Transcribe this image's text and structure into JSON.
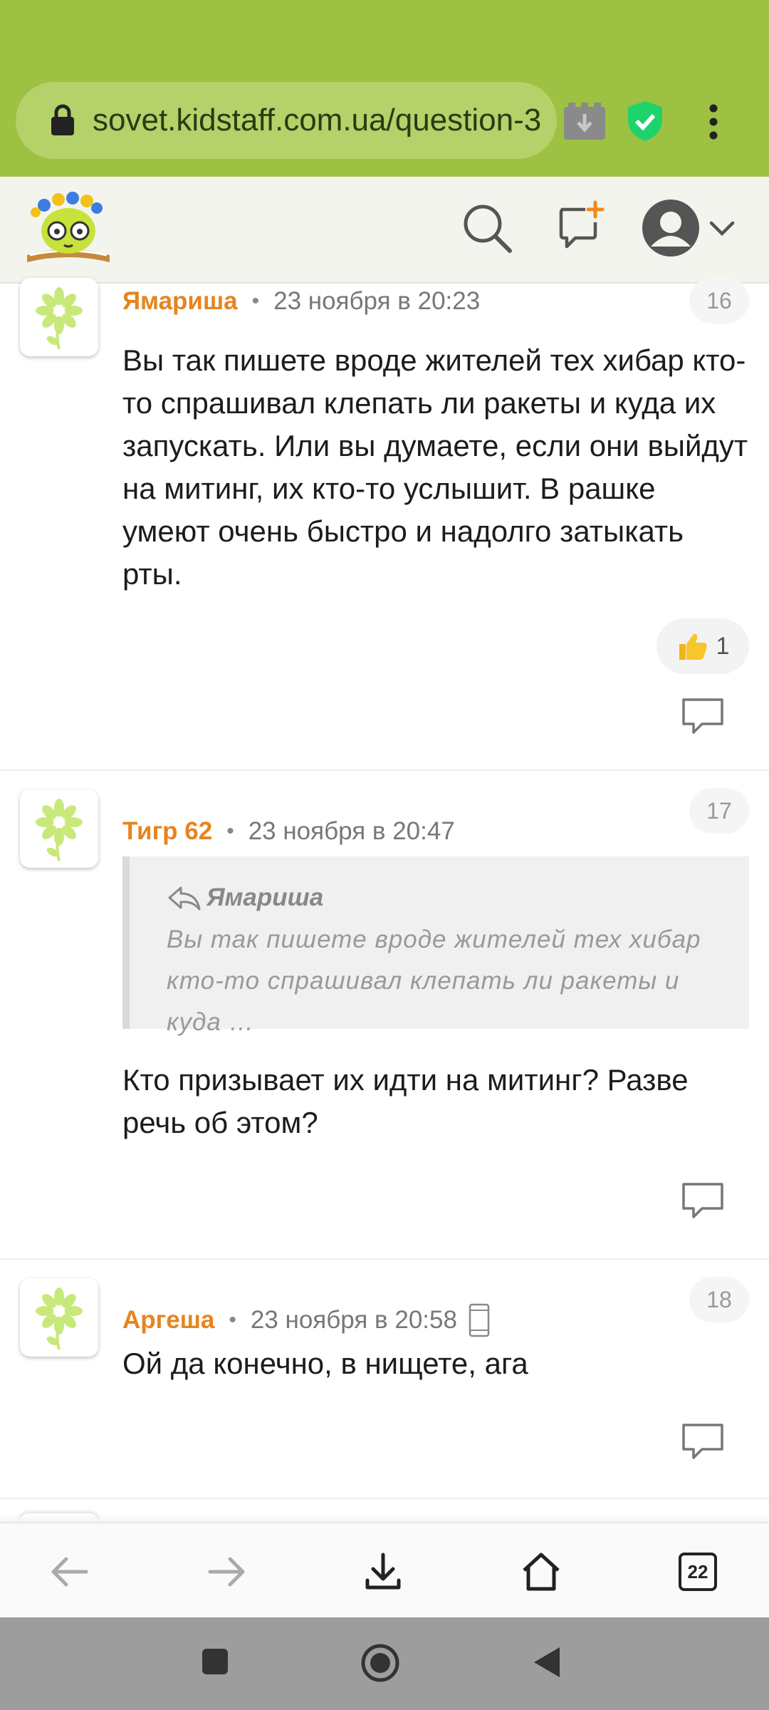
{
  "browser": {
    "url": "sovet.kidstaff.com.ua/question-3",
    "tab_count": "22"
  },
  "comments": [
    {
      "author": "Ямариша",
      "date": "23 ноября в 20:23",
      "number": "16",
      "text": "Вы так пишете вроде жителей тех хибар кто-то спрашивал клепать ли ракеты и куда их запускать. Или вы думаете, если они выйдут на митинг, их кто-то услышит. В рашке умеют очень быстро и надолго затыкать рты.",
      "likes": "1"
    },
    {
      "author": "Тигр 62",
      "date": "23 ноября в 20:47",
      "number": "17",
      "quote_author": "Ямариша",
      "quote_text": "Вы так пишете вроде жителей тех хибар кто-то спрашивал клепать ли ракеты и куда …",
      "text": "Кто призывает их идти на митинг? Разве речь об этом?"
    },
    {
      "author": "Аргеша",
      "date": "23 ноября в 20:58",
      "number": "18",
      "text": "Ой да конечно, в нищете, ага"
    }
  ],
  "colors": {
    "browser_bar": "#9dc143",
    "author": "#e6841f",
    "shield": "#1fd36b"
  }
}
